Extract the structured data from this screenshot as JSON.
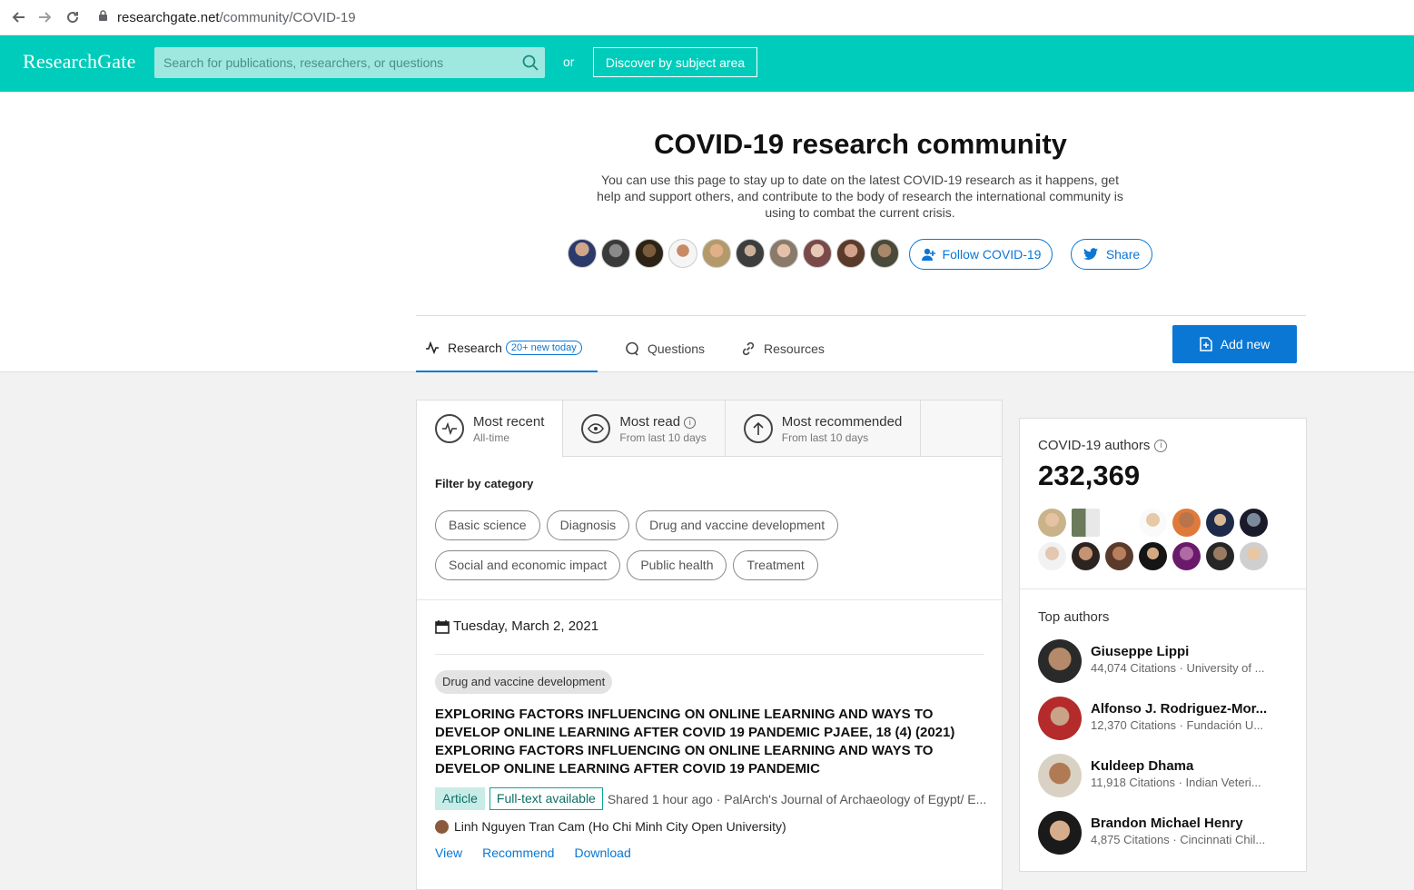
{
  "browser": {
    "url_host": "researchgate.net",
    "url_path": "/community/COVID-19"
  },
  "header": {
    "logo": "ResearchGate",
    "search_placeholder": "Search for publications, researchers, or questions",
    "or_label": "or",
    "discover_label": "Discover by subject area"
  },
  "hero": {
    "title": "COVID-19 research community",
    "description": "You can use this page to stay up to date on the latest COVID-19 research as it happens, get help and support others, and contribute to the body of research the international community is using to combat the current crisis.",
    "follow_label": "Follow COVID-19",
    "share_label": "Share"
  },
  "tabs": {
    "research": "Research",
    "research_badge": "20+ new today",
    "questions": "Questions",
    "resources": "Resources",
    "add_new": "Add new"
  },
  "sort_tabs": [
    {
      "label": "Most recent",
      "sub": "All-time"
    },
    {
      "label": "Most read",
      "sub": "From last 10 days"
    },
    {
      "label": "Most recommended",
      "sub": "From last 10 days"
    }
  ],
  "filter": {
    "title": "Filter by category",
    "chips": [
      "Basic science",
      "Diagnosis",
      "Drug and vaccine development",
      "Social and economic impact",
      "Public health",
      "Treatment"
    ]
  },
  "feed": {
    "date": "Tuesday, March 2, 2021",
    "category": "Drug and vaccine development",
    "title": "EXPLORING FACTORS INFLUENCING ON ONLINE LEARNING AND WAYS TO DEVELOP ONLINE LEARNING AFTER COVID 19 PANDEMIC PJAEE, 18 (4) (2021) EXPLORING FACTORS INFLUENCING ON ONLINE LEARNING AND WAYS TO DEVELOP ONLINE LEARNING AFTER COVID 19 PANDEMIC",
    "type_badge": "Article",
    "fulltext_badge": "Full-text available",
    "meta": "Shared 1 hour ago · PalArch's Journal of Archaeology of Egypt/ E...",
    "author": "Linh Nguyen Tran Cam (Ho Chi Minh City Open University)",
    "actions": [
      "View",
      "Recommend",
      "Download"
    ]
  },
  "sidebar": {
    "authors_title": "COVID-19 authors",
    "authors_count": "232,369",
    "top_title": "Top authors",
    "top_authors": [
      {
        "name": "Giuseppe Lippi",
        "citations": "44,074 Citations · University of ..."
      },
      {
        "name": "Alfonso J. Rodriguez-Mor...",
        "citations": "12,370 Citations · Fundación U..."
      },
      {
        "name": "Kuldeep Dhama",
        "citations": "11,918 Citations · Indian Veteri..."
      },
      {
        "name": "Brandon Michael Henry",
        "citations": "4,875 Citations · Cincinnati Chil..."
      }
    ]
  },
  "colors": {
    "brand": "#00ccbb",
    "link": "#0a77d5"
  }
}
